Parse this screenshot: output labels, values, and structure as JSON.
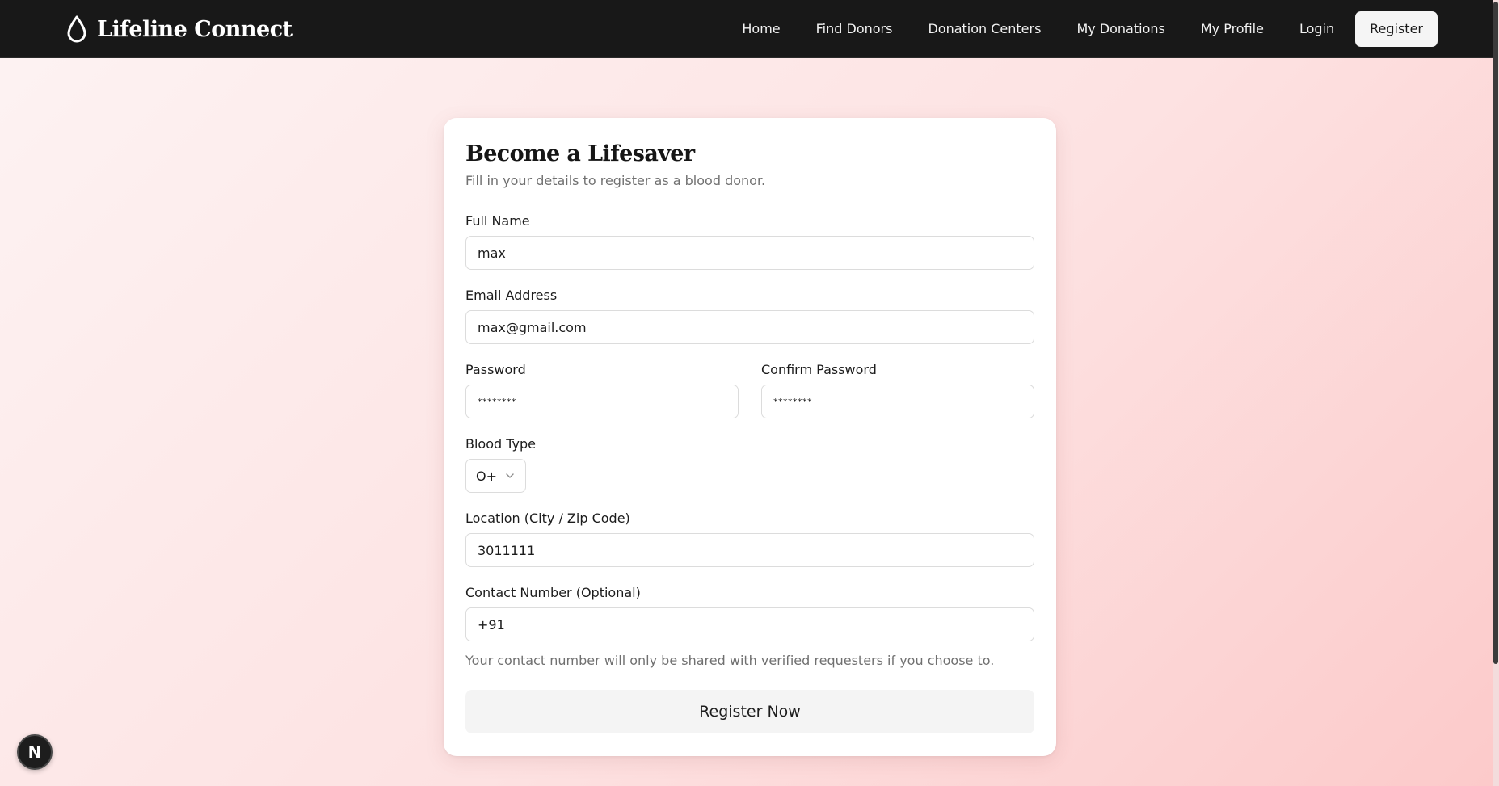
{
  "header": {
    "brand": "Lifeline Connect",
    "brand_icon": "blood-drop-icon",
    "nav": [
      {
        "label": "Home"
      },
      {
        "label": "Find Donors"
      },
      {
        "label": "Donation Centers"
      },
      {
        "label": "My Donations"
      },
      {
        "label": "My Profile"
      },
      {
        "label": "Login"
      }
    ],
    "register_label": "Register"
  },
  "form": {
    "title": "Become a Lifesaver",
    "subtitle": "Fill in your details to register as a blood donor.",
    "full_name": {
      "label": "Full Name",
      "value": "max"
    },
    "email": {
      "label": "Email Address",
      "value": "max@gmail.com"
    },
    "password": {
      "label": "Password",
      "value": "********"
    },
    "confirm_password": {
      "label": "Confirm Password",
      "value": "********"
    },
    "blood_type": {
      "label": "Blood Type",
      "value": "O+"
    },
    "location": {
      "label": "Location (City / Zip Code)",
      "value": "3011111"
    },
    "contact": {
      "label": "Contact Number (Optional)",
      "value": "+91"
    },
    "contact_hint": "Your contact number will only be shared with verified requesters if you choose to.",
    "submit_label": "Register Now"
  },
  "badge": {
    "label": "N"
  },
  "colors": {
    "header_bg": "#181818",
    "page_gradient_start": "#fdf3f3",
    "page_gradient_end": "#fccaca",
    "button_bg": "#f4f4f4"
  }
}
